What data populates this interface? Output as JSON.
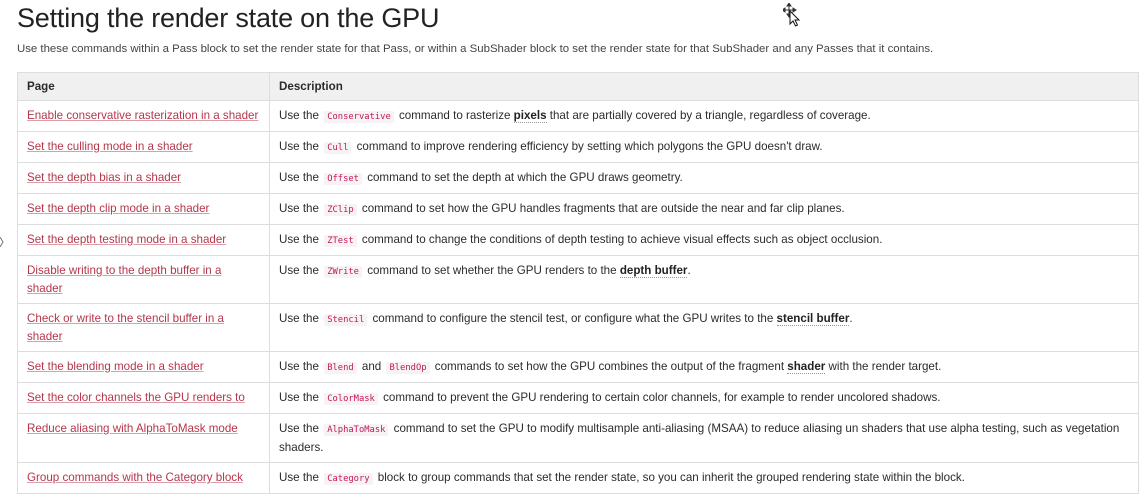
{
  "heading": "Setting the render state on the GPU",
  "intro": "Use these commands within a Pass block to set the render state for that Pass, or within a SubShader block to set the render state for that SubShader and any Passes that it contains.",
  "table": {
    "headers": [
      "Page",
      "Description"
    ],
    "rows": [
      {
        "page": "Enable conservative rasterization in a shader",
        "desc": [
          {
            "t": "Use the "
          },
          {
            "code": "Conservative"
          },
          {
            "t": " command to rasterize "
          },
          {
            "b": "pixels"
          },
          {
            "t": " that are partially covered by a triangle, regardless of coverage."
          }
        ]
      },
      {
        "page": "Set the culling mode in a shader",
        "desc": [
          {
            "t": "Use the "
          },
          {
            "code": "Cull"
          },
          {
            "t": " command to improve rendering efficiency by setting which polygons the GPU doesn't draw."
          }
        ]
      },
      {
        "page": "Set the depth bias in a shader",
        "desc": [
          {
            "t": "Use the "
          },
          {
            "code": "Offset"
          },
          {
            "t": " command to set the depth at which the GPU draws geometry."
          }
        ]
      },
      {
        "page": "Set the depth clip mode in a shader",
        "desc": [
          {
            "t": "Use the "
          },
          {
            "code": "ZClip"
          },
          {
            "t": " command to set how the GPU handles fragments that are outside the near and far clip planes."
          }
        ]
      },
      {
        "page": "Set the depth testing mode in a shader",
        "desc": [
          {
            "t": "Use the "
          },
          {
            "code": "ZTest"
          },
          {
            "t": " command to change the conditions of depth testing to achieve visual effects such as object occlusion."
          }
        ]
      },
      {
        "page": "Disable writing to the depth buffer in a shader",
        "desc": [
          {
            "t": "Use the "
          },
          {
            "code": "ZWrite"
          },
          {
            "t": " command to set whether the GPU renders to the "
          },
          {
            "b": "depth buffer"
          },
          {
            "t": "."
          }
        ]
      },
      {
        "page": "Check or write to the stencil buffer in a shader",
        "desc": [
          {
            "t": "Use the "
          },
          {
            "code": "Stencil"
          },
          {
            "t": " command to configure the stencil test, or configure what the GPU writes to the "
          },
          {
            "b": "stencil buffer"
          },
          {
            "t": "."
          }
        ]
      },
      {
        "page": "Set the blending mode in a shader",
        "desc": [
          {
            "t": "Use the "
          },
          {
            "code": "Blend"
          },
          {
            "t": " and "
          },
          {
            "code": "BlendOp"
          },
          {
            "t": " commands to set how the GPU combines the output of the fragment "
          },
          {
            "b": "shader"
          },
          {
            "t": " with the render target."
          }
        ]
      },
      {
        "page": "Set the color channels the GPU renders to",
        "desc": [
          {
            "t": "Use the "
          },
          {
            "code": "ColorMask"
          },
          {
            "t": " command to prevent the GPU rendering to certain color channels, for example to render uncolored shadows."
          }
        ]
      },
      {
        "page": "Reduce aliasing with AlphaToMask mode",
        "desc": [
          {
            "t": "Use the "
          },
          {
            "code": "AlphaToMask"
          },
          {
            "t": " command to set the GPU to modify multisample anti-aliasing (MSAA) to reduce aliasing un shaders that use alpha testing, such as vegetation shaders."
          }
        ]
      },
      {
        "page": "Group commands with the Category block",
        "desc": [
          {
            "t": "Use the "
          },
          {
            "code": "Category"
          },
          {
            "t": " block to group commands that set the render state, so you can inherit the grouped rendering state within the block."
          }
        ]
      }
    ]
  },
  "icons": {
    "cursor": "move-cursor-icon"
  }
}
